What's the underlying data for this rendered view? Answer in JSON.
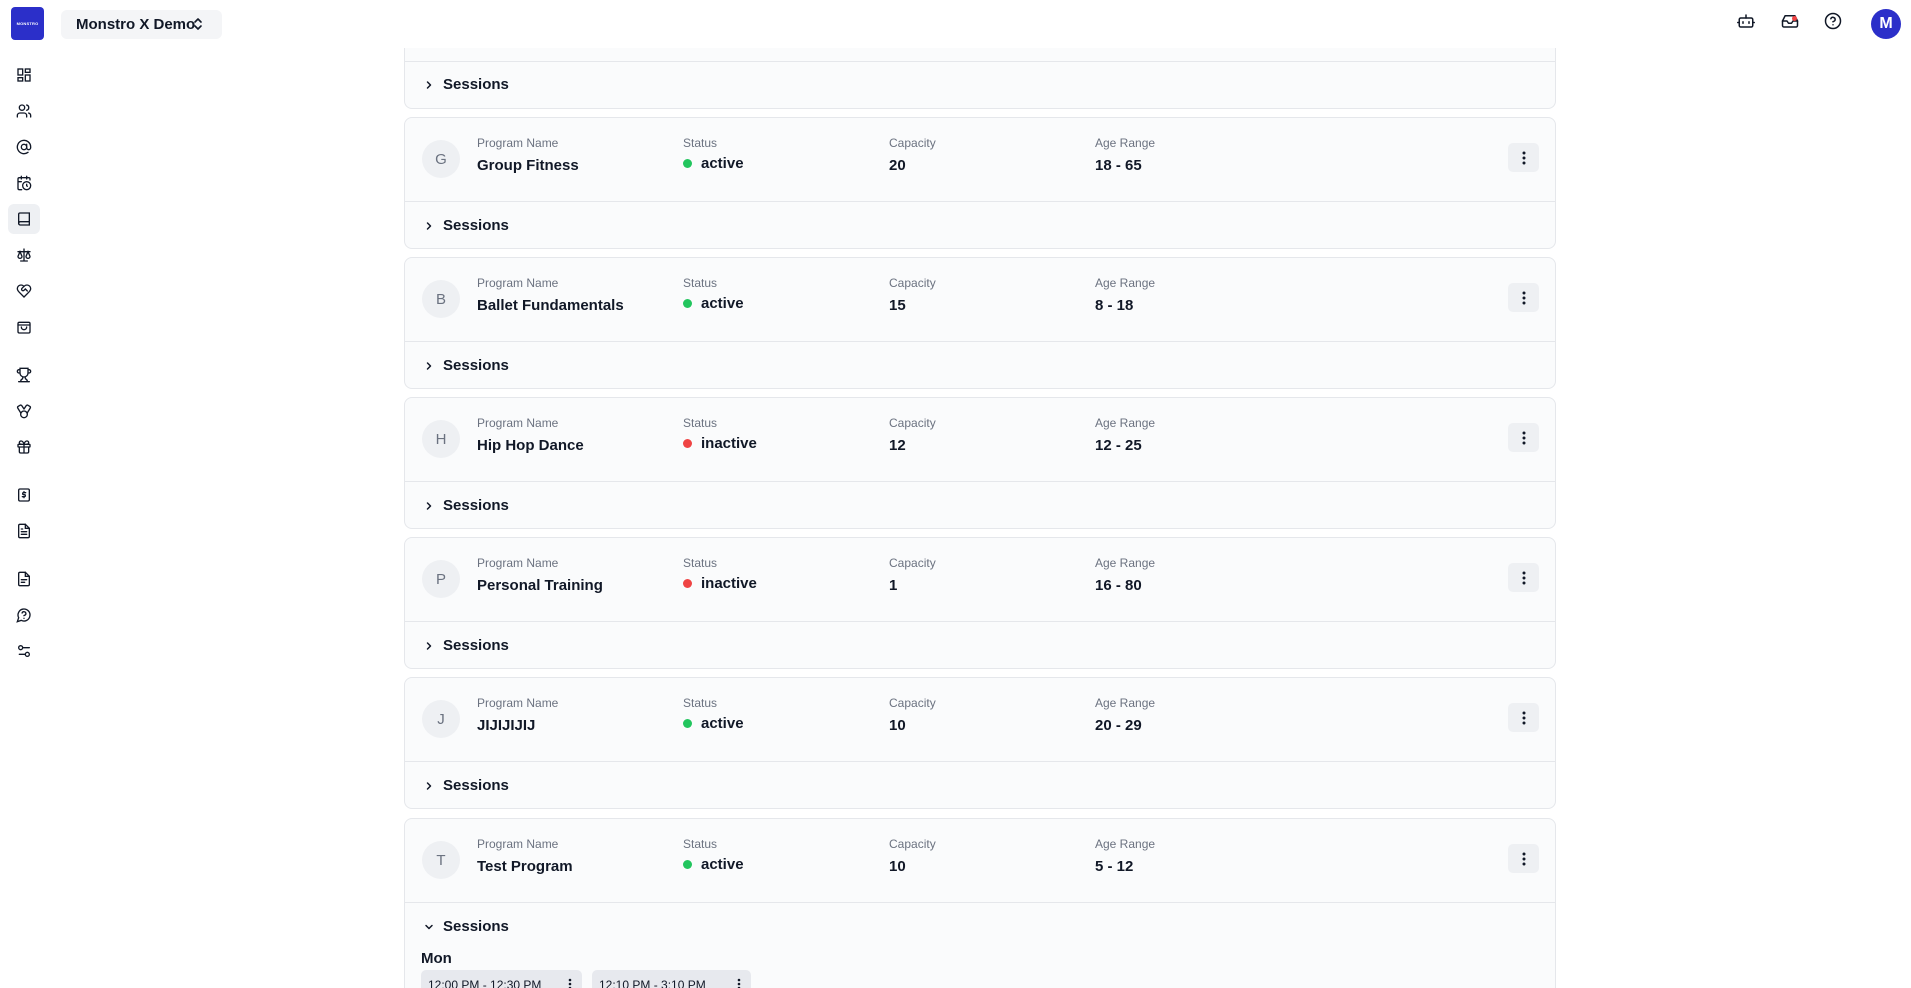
{
  "app": {
    "logo_text": "MONSTRO",
    "org_name": "Monstro X Demo",
    "avatar_letter": "M"
  },
  "topbar_icons": [
    "bot-icon",
    "inbox-icon",
    "help-circle-icon"
  ],
  "sidebar": {
    "items": [
      {
        "name": "dashboard-icon"
      },
      {
        "name": "users-icon"
      },
      {
        "name": "at-sign-icon"
      },
      {
        "name": "calendar-clock-icon"
      },
      {
        "name": "book-icon",
        "active": true
      },
      {
        "name": "scale-icon"
      },
      {
        "name": "heart-handshake-icon"
      },
      {
        "name": "shopping-bag-icon"
      },
      {
        "name": "trophy-icon"
      },
      {
        "name": "medal-icon"
      },
      {
        "name": "gift-icon"
      },
      {
        "name": "dollar-receipt-icon"
      },
      {
        "name": "file-text-icon"
      },
      {
        "name": "document-icon"
      },
      {
        "name": "help-icon"
      },
      {
        "name": "settings-sliders-icon"
      }
    ]
  },
  "labels": {
    "program_name": "Program Name",
    "status": "Status",
    "capacity": "Capacity",
    "age_range": "Age Range",
    "sessions": "Sessions"
  },
  "colors": {
    "active": "#22c55e",
    "inactive": "#ef4444",
    "brand": "#2b2fc9"
  },
  "programs": [
    {
      "initial": "G",
      "name": "Group Fitness",
      "status": "active",
      "capacity": "20",
      "age_range": "18 - 65"
    },
    {
      "initial": "B",
      "name": "Ballet Fundamentals",
      "status": "active",
      "capacity": "15",
      "age_range": "8 - 18"
    },
    {
      "initial": "H",
      "name": "Hip Hop Dance",
      "status": "inactive",
      "capacity": "12",
      "age_range": "12 - 25"
    },
    {
      "initial": "P",
      "name": "Personal Training",
      "status": "inactive",
      "capacity": "1",
      "age_range": "16 - 80"
    },
    {
      "initial": "J",
      "name": "JIJIJIJIJ",
      "status": "active",
      "capacity": "10",
      "age_range": "20 - 29"
    },
    {
      "initial": "T",
      "name": "Test Program",
      "status": "active",
      "capacity": "10",
      "age_range": "5 - 12"
    }
  ],
  "open_sessions": {
    "day": "Mon",
    "slots": [
      "12:00 PM - 12:30 PM",
      "12:10 PM - 3:10 PM"
    ]
  }
}
